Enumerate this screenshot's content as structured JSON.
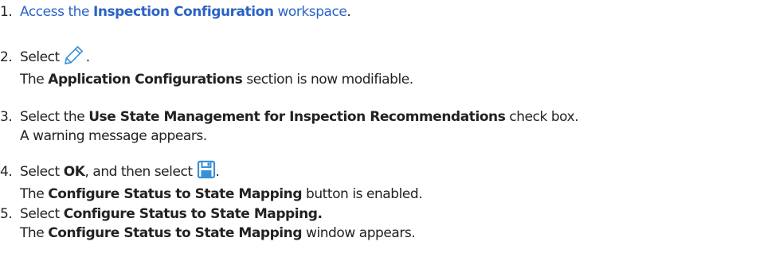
{
  "steps": [
    {
      "number": "1.",
      "parts": [
        "Access the ",
        "Inspection Configuration",
        " workspace",
        "."
      ]
    },
    {
      "number": "2.",
      "line1": [
        "Select ",
        "."
      ],
      "icon": "pencil-edit-icon",
      "line2": [
        "The ",
        "Application Configurations",
        " section is now modifiable."
      ]
    },
    {
      "number": "3.",
      "line1": [
        "Select the ",
        "Use State Management for Inspection Recommendations",
        " check box."
      ],
      "line2": "A warning message appears."
    },
    {
      "number": "4.",
      "line1": [
        "Select ",
        "OK",
        ", and then select ",
        "."
      ],
      "icon": "floppy-save-icon",
      "line2": [
        "The ",
        "Configure Status to State Mapping",
        " button is enabled."
      ]
    },
    {
      "number": "5.",
      "line1": [
        "Select ",
        "Configure Status to State Mapping."
      ],
      "line2": [
        "The ",
        "Configure Status to State Mapping",
        " window appears."
      ]
    }
  ],
  "colors": {
    "text": "#222222",
    "link": "#2b63c6",
    "icon_blue": "#3a8fd6"
  }
}
